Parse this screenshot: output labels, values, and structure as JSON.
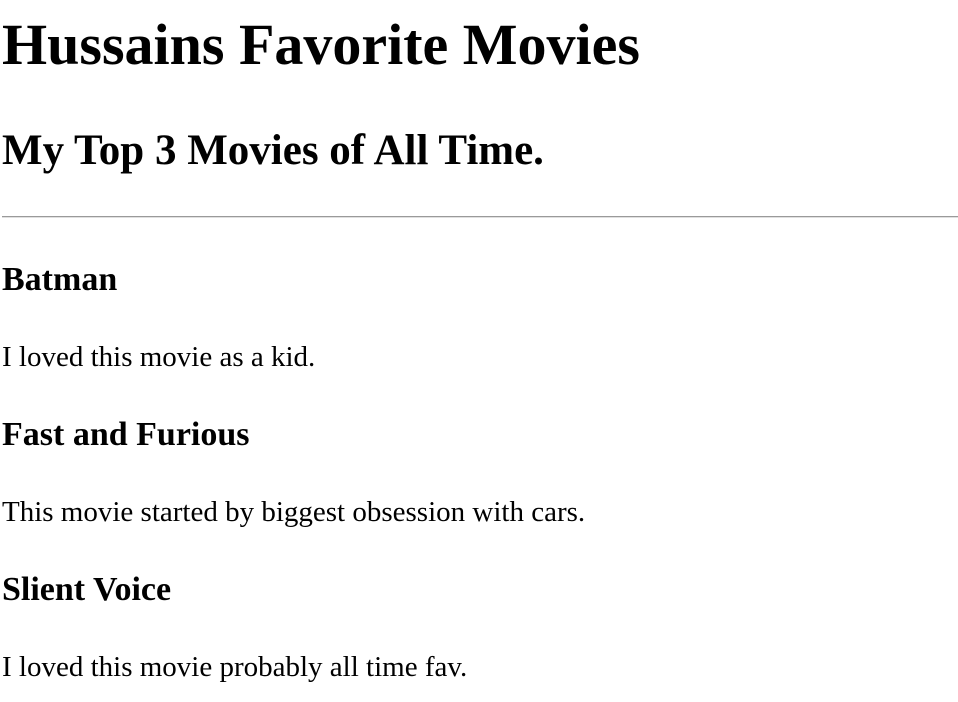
{
  "page": {
    "title": "Hussains Favorite Movies",
    "subtitle": "My Top 3 Movies of All Time."
  },
  "movies": [
    {
      "title": "Batman",
      "description": "I loved this movie as a kid."
    },
    {
      "title": "Fast and Furious",
      "description": "This movie started by biggest obsession with cars."
    },
    {
      "title": "Slient Voice",
      "description": "I loved this movie probably all time fav."
    }
  ]
}
